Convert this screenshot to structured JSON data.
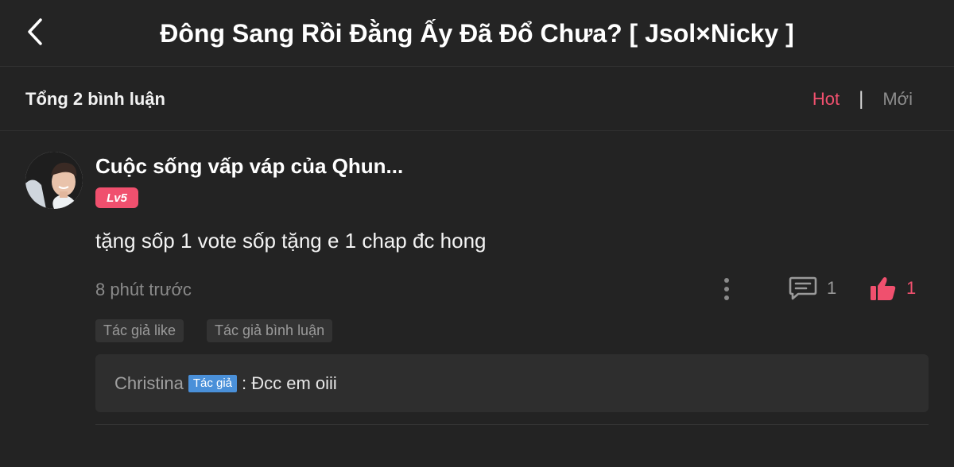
{
  "header": {
    "title": "Đông Sang Rồi Đằng Ấy Đã Đổ Chưa? [ Jsol×Nicky ]",
    "back_icon": "chevron-left-icon"
  },
  "subbar": {
    "total_label": "Tổng 2 bình luận",
    "sort_hot": "Hot",
    "sort_separator": "|",
    "sort_new": "Mới",
    "active_color": "#f0506e"
  },
  "comment": {
    "username": "Cuộc sống vấp váp của Qhun...",
    "level": "Lv5",
    "text": "tặng sốp 1 vote sốp tặng e 1 chap đc hong",
    "time": "8 phút trước",
    "reply_count": "1",
    "like_count": "1",
    "tags": [
      "Tác giả like",
      "Tác giả bình luận"
    ],
    "reply": {
      "author": "Christina",
      "badge": "Tác giả",
      "text": ": Đcc em oiii"
    }
  },
  "colors": {
    "background": "#232323",
    "accent": "#f0506e",
    "author_badge": "#4a90d9"
  }
}
